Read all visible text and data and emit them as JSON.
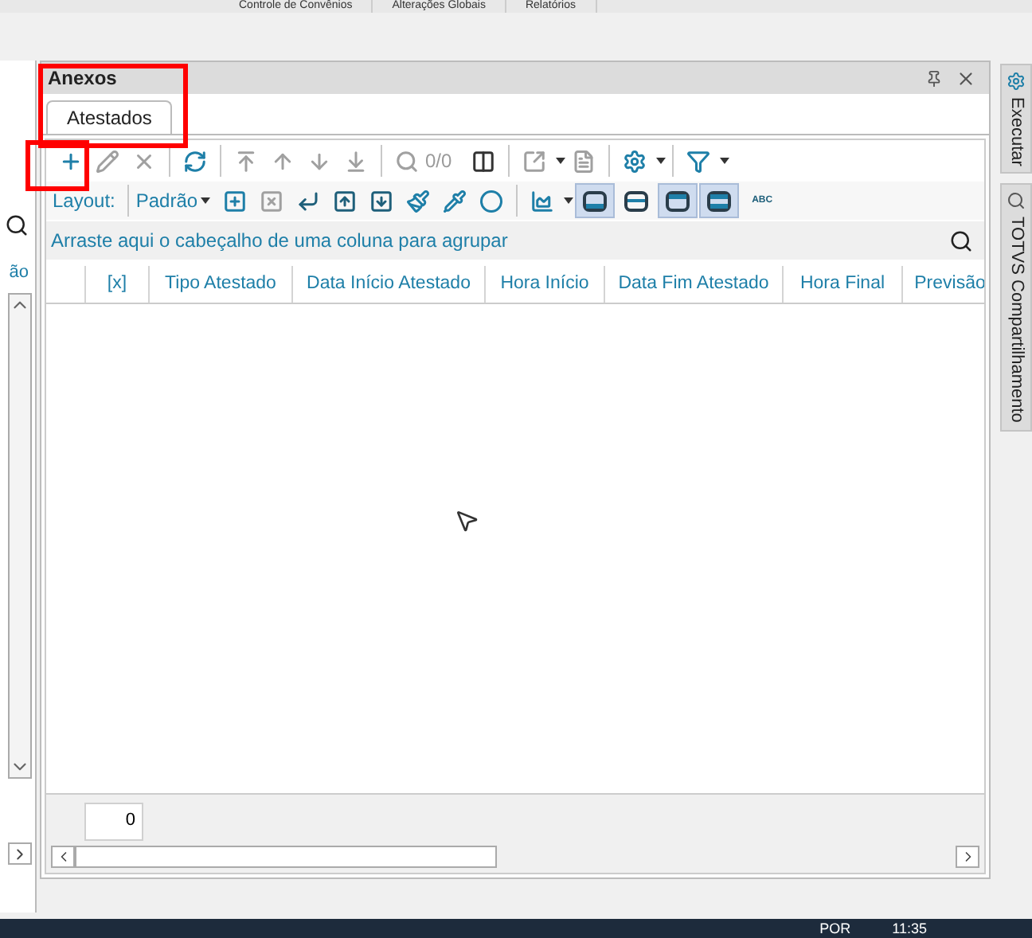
{
  "top_tabs": [
    "Controle de Convênios",
    "Alterações Globais",
    "Relatórios"
  ],
  "left_panel": {
    "partial_label": "ão"
  },
  "panel": {
    "title": "Anexos",
    "tabs": [
      {
        "label": "Atestados",
        "selected": true
      }
    ],
    "toolbar": {
      "counter": "0/0"
    },
    "layout_bar": {
      "label": "Layout:",
      "value": "Padrão",
      "abc": "ABC",
      "view_toggles": [
        {
          "selected": true
        },
        {
          "selected": false
        },
        {
          "selected": true
        },
        {
          "selected": true
        }
      ]
    },
    "group_hint": "Arraste aqui o cabeçalho de uma coluna para agrupar",
    "columns": [
      "",
      "[x]",
      "Tipo Atestado",
      "Data Início Atestado",
      "Hora Início",
      "Data Fim Atestado",
      "Hora Final",
      "Previsão"
    ],
    "footer_count": "0"
  },
  "side_tabs": [
    "Executar",
    "TOTVS Compartilhamento"
  ],
  "taskbar": {
    "language": "POR",
    "time": "11:35"
  }
}
